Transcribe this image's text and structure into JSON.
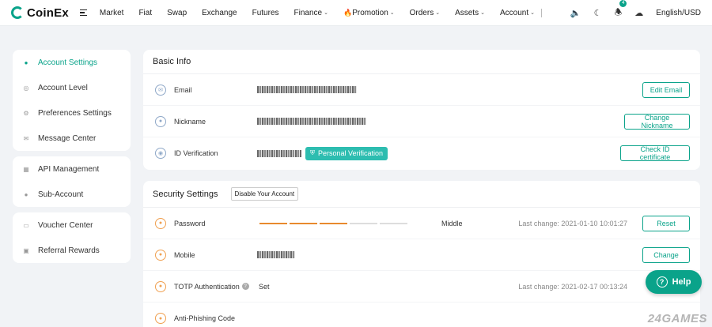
{
  "brand": {
    "name": "CoinEx",
    "accent": "#0aa38a"
  },
  "nav": {
    "items": [
      "Market",
      "Fiat",
      "Swap",
      "Exchange",
      "Futures",
      "Finance",
      "Promotion",
      "Orders",
      "Assets",
      "Account"
    ],
    "promotion_icon": "🔥",
    "notification_count": "4",
    "language": "English/USD"
  },
  "sidebar": {
    "groups": [
      [
        "Account Settings",
        "Account Level",
        "Preferences Settings",
        "Message Center"
      ],
      [
        "API Management",
        "Sub-Account"
      ],
      [
        "Voucher Center",
        "Referral Rewards"
      ]
    ]
  },
  "basic_info": {
    "title": "Basic Info",
    "email_label": "Email",
    "email_button": "Edit Email",
    "nickname_label": "Nickname",
    "nickname_button": "Change Nickname",
    "id_label": "ID Verification",
    "id_tag": "Personal Verification",
    "id_button": "Check ID certificate"
  },
  "security": {
    "title": "Security Settings",
    "disable_button": "Disable Your Account",
    "password_label": "Password",
    "password_strength": "Middle",
    "password_strength_level": 3,
    "password_strength_max": 5,
    "password_last_change": "Last change: 2021-01-10 10:01:27",
    "password_button": "Reset",
    "mobile_label": "Mobile",
    "mobile_button": "Change",
    "totp_label": "TOTP Authentication",
    "totp_value": "Set",
    "totp_last_change": "Last change: 2021-02-17 00:13:24",
    "antiphishing_label": "Anti-Phishing Code"
  },
  "help_label": "Help",
  "watermark": "24GAMES"
}
